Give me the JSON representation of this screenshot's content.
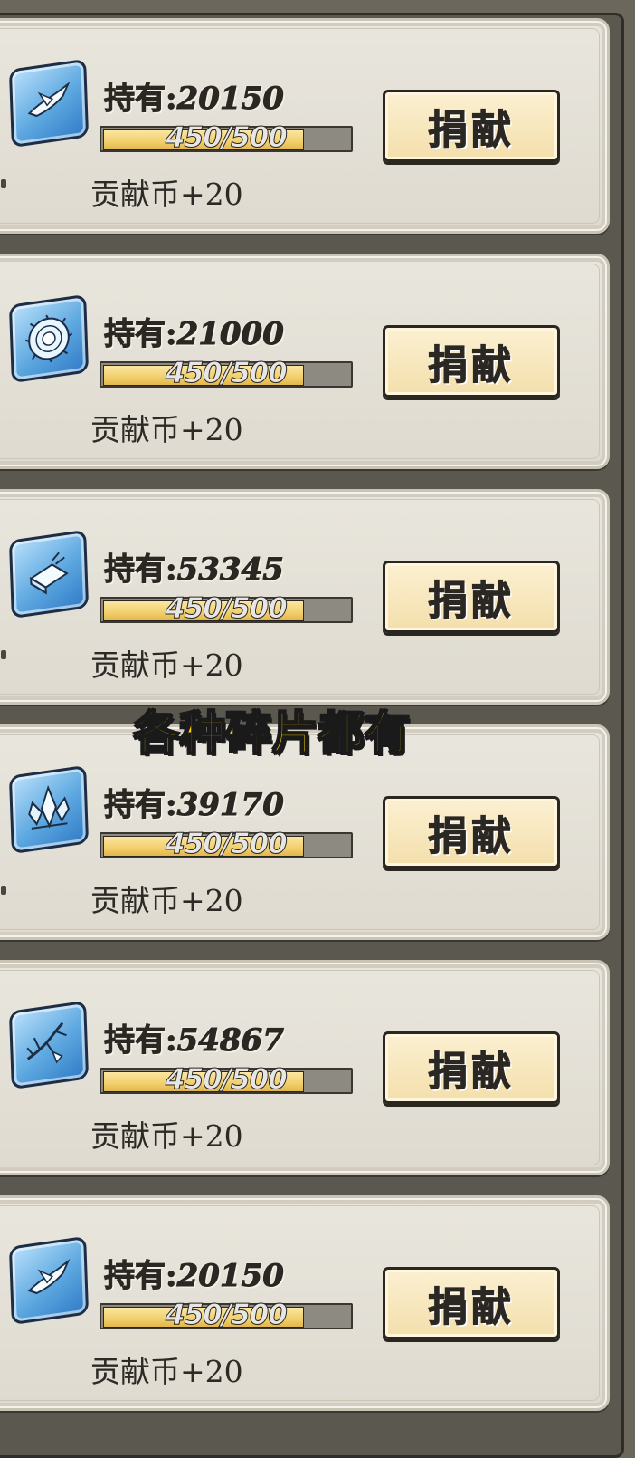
{
  "overlay_caption": "各种碎片都有",
  "item_cards": [
    {
      "owned_label": "持有",
      "owned_separator": ":",
      "owned_count": "20150",
      "progress_text": "450/500",
      "progress_value": 0.9,
      "reward_text": "贡献币+20",
      "donate_label": "捐献",
      "fragment_icon": "bird-fragment-icon"
    },
    {
      "owned_label": "持有",
      "owned_separator": ":",
      "owned_count": "21000",
      "progress_text": "450/500",
      "progress_value": 0.9,
      "reward_text": "贡献币+20",
      "donate_label": "捐献",
      "fragment_icon": "ring-fragment-icon"
    },
    {
      "owned_label": "持有",
      "owned_separator": ":",
      "owned_count": "53345",
      "progress_text": "450/500",
      "progress_value": 0.9,
      "reward_text": "贡献币+20",
      "donate_label": "捐献",
      "fragment_icon": "box-fragment-icon"
    },
    {
      "owned_label": "持有",
      "owned_separator": ":",
      "owned_count": "39170",
      "progress_text": "450/500",
      "progress_value": 0.9,
      "reward_text": "贡献币+20",
      "donate_label": "捐献",
      "fragment_icon": "crystal-fragment-icon"
    },
    {
      "owned_label": "持有",
      "owned_separator": ":",
      "owned_count": "54867",
      "progress_text": "450/500",
      "progress_value": 0.9,
      "reward_text": "贡献币+20",
      "donate_label": "捐献",
      "fragment_icon": "branch-fragment-icon"
    },
    {
      "owned_label": "持有",
      "owned_separator": ":",
      "owned_count": "20150",
      "progress_text": "450/500",
      "progress_value": 0.9,
      "reward_text": "贡献币+20",
      "donate_label": "捐献",
      "fragment_icon": "bird-fragment-icon"
    }
  ],
  "colors": {
    "background": "#6b675d",
    "card": "#e5e1d7",
    "bar_fill": "#f1cf6b",
    "button": "#f7e5b8",
    "caption": "#ffd400"
  }
}
